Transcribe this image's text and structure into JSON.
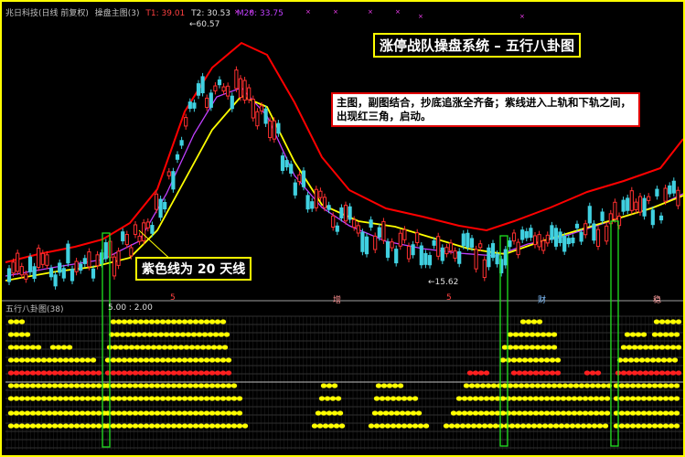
{
  "header": {
    "stock_title": "兆日科技(日线 前复权)",
    "indicator_name": "操盘主图(3)",
    "t1_label": "T1: 39.01",
    "t2_label": "T2: 30.53",
    "m20_label": "M20: 33.75"
  },
  "price_marks": {
    "high": "60.57",
    "low": "15.62"
  },
  "annotations": {
    "title": "涨停战队操盘系统 – 五行八卦图",
    "note": "主图，副图结合，抄底追涨全齐备；紫线进入上轨和下轨之间，出现红三角，启动。",
    "purple_line": "紫色线为 20 天线"
  },
  "subchart": {
    "title": "五行八卦图(38)",
    "values": "5.00 : 2.00"
  },
  "phase_labels": [
    "5",
    "增",
    "5",
    "财",
    "稳"
  ],
  "colors": {
    "background": "#000000",
    "border": "#ffff00",
    "up_candle": "#ff3030",
    "down_candle": "#40d0e0",
    "upper_band": "#ff0000",
    "ma20": "#c040ff",
    "lower_band": "#ffff00",
    "highlight_box": "#20e020",
    "dot_yellow": "#ffff00",
    "dot_red": "#ff2020"
  }
}
